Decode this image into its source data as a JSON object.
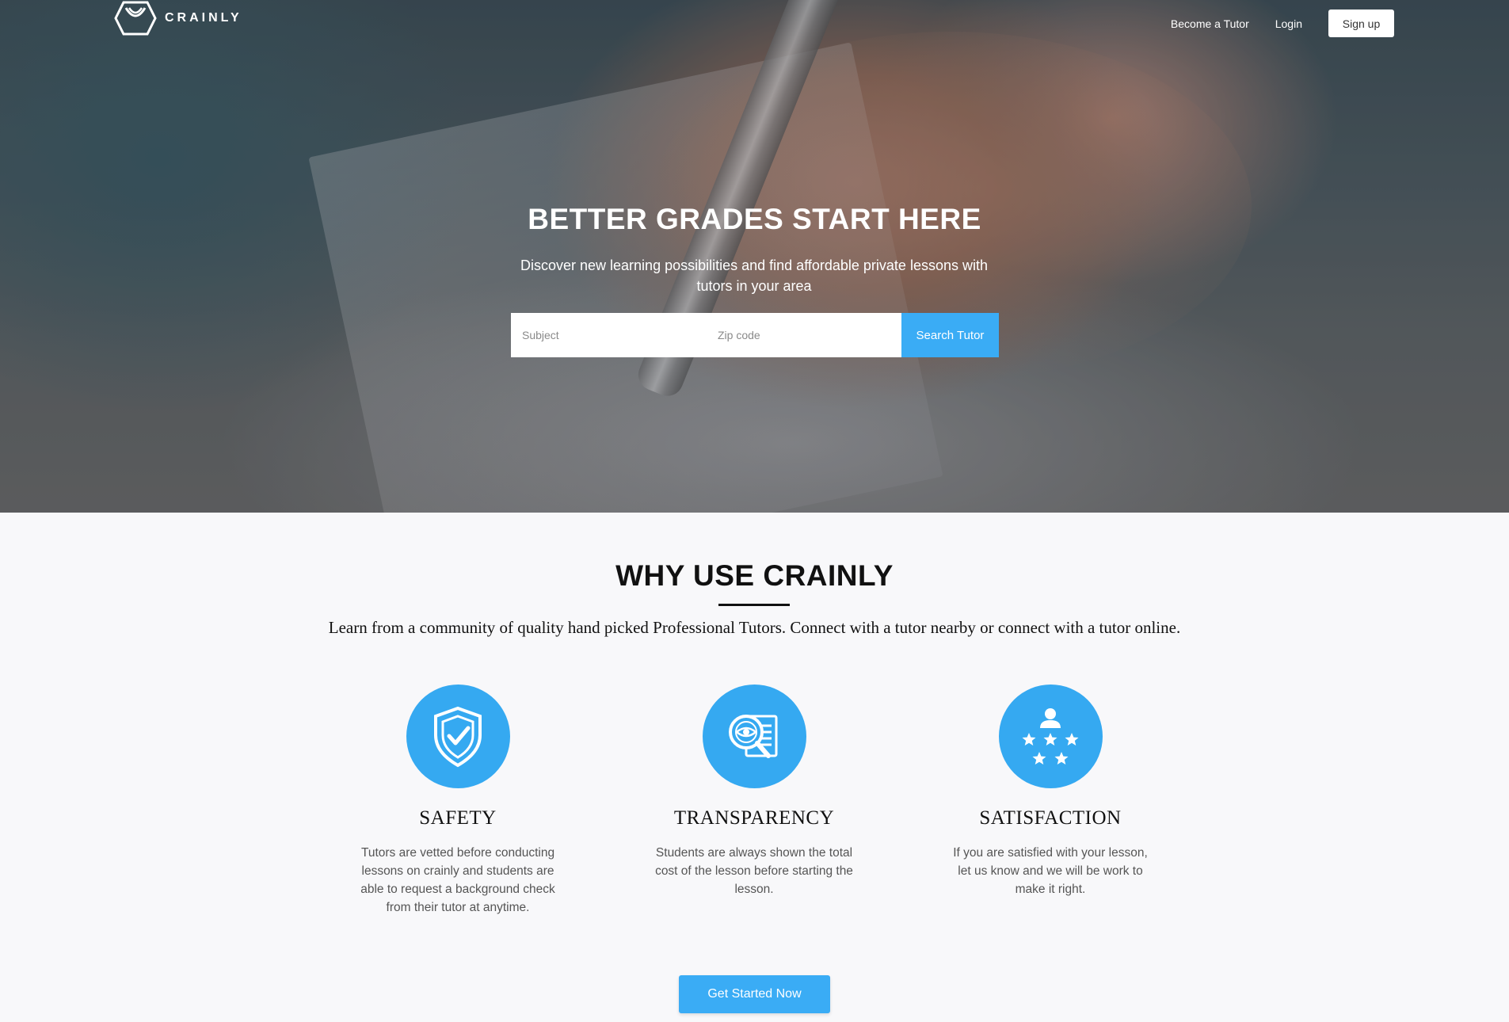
{
  "brand": {
    "name": "CRAINLY",
    "logo_icon": "crainly-hexagon-logo"
  },
  "nav": {
    "become_tutor": "Become a Tutor",
    "login": "Login",
    "signup": "Sign up"
  },
  "hero": {
    "title": "BETTER GRADES START HERE",
    "subtitle": "Discover new learning possibilities and find affordable private lessons with tutors in your area",
    "subject_placeholder": "Subject",
    "zip_placeholder": "Zip code",
    "search_button": "Search Tutor"
  },
  "why": {
    "title": "WHY USE CRAINLY",
    "description": "Learn from a community of quality hand picked Professional Tutors. Connect with a tutor nearby or connect with a tutor online."
  },
  "features": [
    {
      "icon": "shield-check-icon",
      "title": "SAFETY",
      "text": "Tutors are vetted before conducting lessons on crainly and students are able to request a background check from their tutor at anytime."
    },
    {
      "icon": "magnifier-document-icon",
      "title": "TRANSPARENCY",
      "text": "Students are always shown the total cost of the lesson before starting the lesson."
    },
    {
      "icon": "user-stars-icon",
      "title": "SATISFACTION",
      "text": "If you are satisfied with your lesson, let us know and we will be work to make it right."
    }
  ],
  "cta": {
    "label": "Get Started Now"
  },
  "colors": {
    "accent": "#3aacf5",
    "icon_circle": "#35a9f1",
    "page_bg": "#f8f8fa"
  }
}
